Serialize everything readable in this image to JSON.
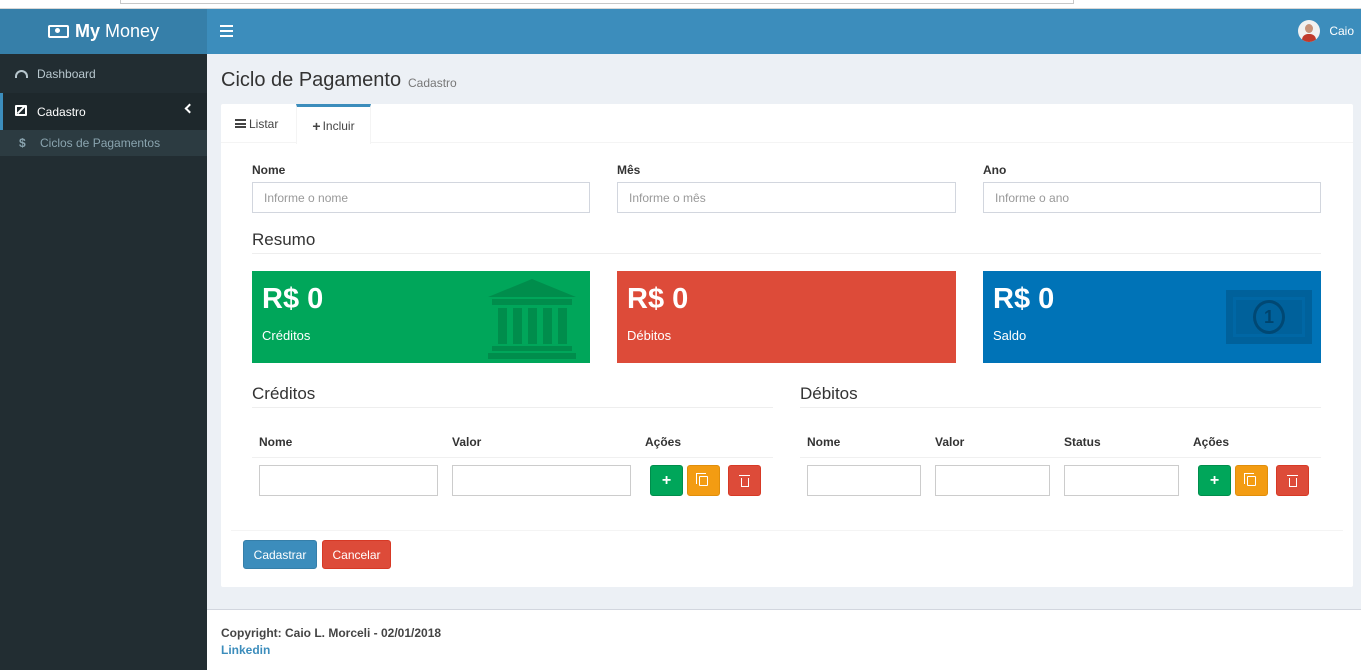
{
  "app": {
    "logo_bold": "My",
    "logo_rest": "Money"
  },
  "header": {
    "user_name": "Caio"
  },
  "sidebar": {
    "items": [
      {
        "label": "Dashboard",
        "icon": "dashboard-icon"
      },
      {
        "label": "Cadastro",
        "icon": "edit-icon"
      }
    ],
    "subitems": [
      {
        "label": "Ciclos de Pagamentos",
        "icon": "dollar-icon"
      }
    ]
  },
  "page": {
    "title": "Ciclo de Pagamento",
    "subtitle": "Cadastro"
  },
  "tabs": [
    {
      "label": "Listar",
      "icon": "list-icon"
    },
    {
      "label": "Incluir",
      "icon": "plus-icon",
      "active": true
    }
  ],
  "form": {
    "nome_label": "Nome",
    "nome_placeholder": "Informe o nome",
    "mes_label": "Mês",
    "mes_placeholder": "Informe o mês",
    "ano_label": "Ano",
    "ano_placeholder": "Informe o ano"
  },
  "resumo": {
    "title": "Resumo",
    "cards": [
      {
        "value": "R$ 0",
        "label": "Créditos",
        "color": "#00a65a",
        "icon": "bank-icon"
      },
      {
        "value": "R$ 0",
        "label": "Débitos",
        "color": "#dd4b39"
      },
      {
        "value": "R$ 0",
        "label": "Saldo",
        "color": "#0073b7",
        "icon": "money-icon"
      }
    ]
  },
  "creditos": {
    "title": "Créditos",
    "columns": [
      "Nome",
      "Valor",
      "Ações"
    ]
  },
  "debitos": {
    "title": "Débitos",
    "columns": [
      "Nome",
      "Valor",
      "Status",
      "Ações"
    ]
  },
  "actions": {
    "add": "+",
    "submit": "Cadastrar",
    "cancel": "Cancelar"
  },
  "footer": {
    "copyright": "Copyright: Caio L. Morceli - 02/01/2018",
    "link": "Linkedin"
  }
}
